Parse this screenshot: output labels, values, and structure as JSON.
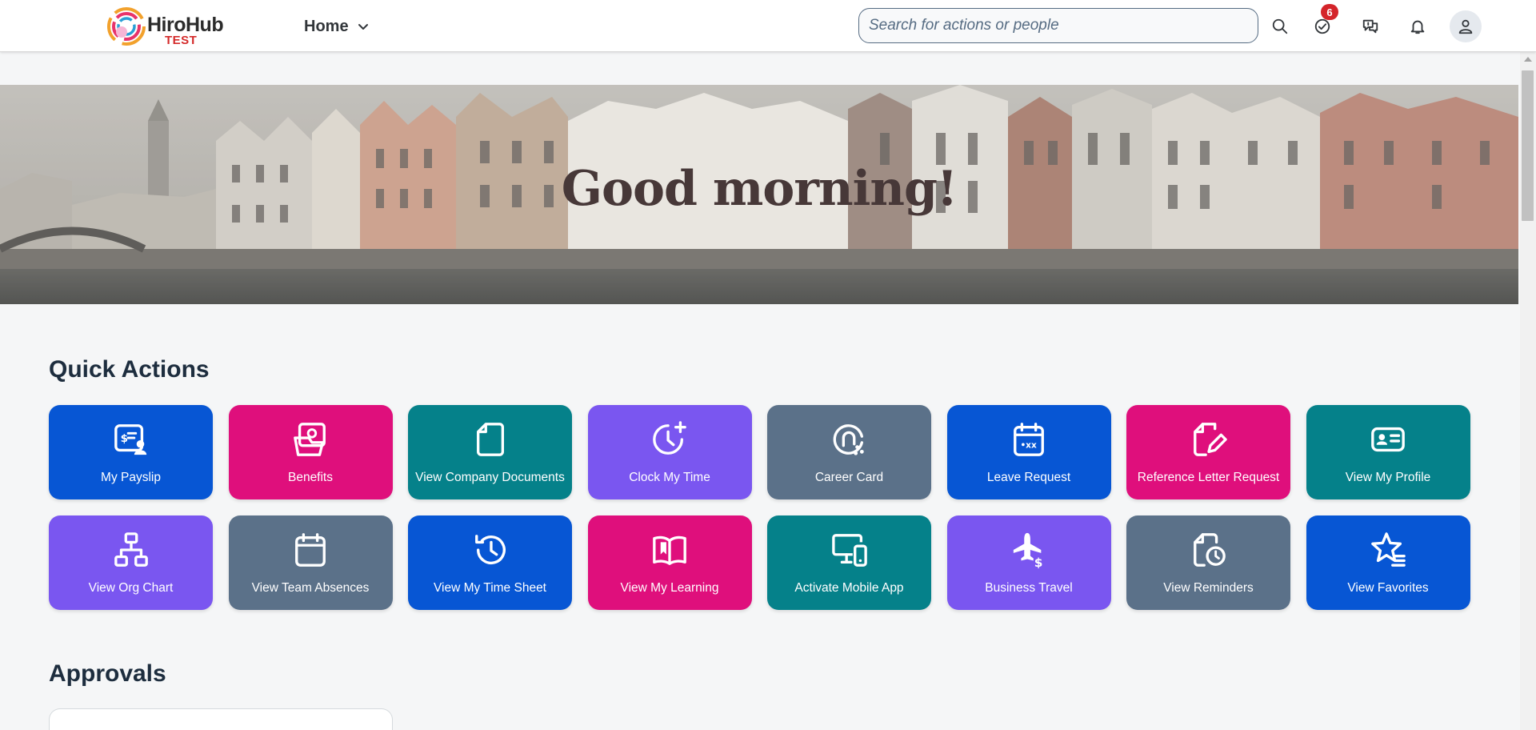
{
  "header": {
    "logo_name": "HiroHub",
    "logo_env": "TEST",
    "nav_label": "Home",
    "search_placeholder": "Search for actions or people",
    "tasks_count": "6",
    "icons": [
      "search-icon",
      "task-check-icon",
      "feedback-icon",
      "bell-icon",
      "user-icon"
    ]
  },
  "hero": {
    "greeting": "Good morning!"
  },
  "quick_actions": {
    "title": "Quick Actions",
    "tiles": [
      {
        "label": "My Payslip",
        "icon": "payslip-icon",
        "color": "#0756d4"
      },
      {
        "label": "Benefits",
        "icon": "benefits-icon",
        "color": "#df0f7c"
      },
      {
        "label": "View Company Documents",
        "icon": "document-icon",
        "color": "#05818a"
      },
      {
        "label": "Clock My Time",
        "icon": "clock-add-icon",
        "color": "#7a56f0"
      },
      {
        "label": "Career Card",
        "icon": "career-card-icon",
        "color": "#5b7189"
      },
      {
        "label": "Leave Request",
        "icon": "calendar-icon",
        "color": "#0756d4"
      },
      {
        "label": "Reference Letter Request",
        "icon": "edit-document-icon",
        "color": "#df0f7c"
      },
      {
        "label": "View My Profile",
        "icon": "id-card-icon",
        "color": "#05818a"
      },
      {
        "label": "View Org Chart",
        "icon": "org-chart-icon",
        "color": "#7a56f0"
      },
      {
        "label": "View Team Absences",
        "icon": "calendar-blank-icon",
        "color": "#5b7189"
      },
      {
        "label": "View My Time Sheet",
        "icon": "history-icon",
        "color": "#0756d4"
      },
      {
        "label": "View My Learning",
        "icon": "open-book-icon",
        "color": "#df0f7c"
      },
      {
        "label": "Activate Mobile App",
        "icon": "devices-icon",
        "color": "#05818a"
      },
      {
        "label": "Business Travel",
        "icon": "plane-dollar-icon",
        "color": "#7a56f0"
      },
      {
        "label": "View Reminders",
        "icon": "document-clock-icon",
        "color": "#5b7189"
      },
      {
        "label": "View Favorites",
        "icon": "star-list-icon",
        "color": "#0756d4"
      }
    ]
  },
  "approvals": {
    "title": "Approvals"
  }
}
